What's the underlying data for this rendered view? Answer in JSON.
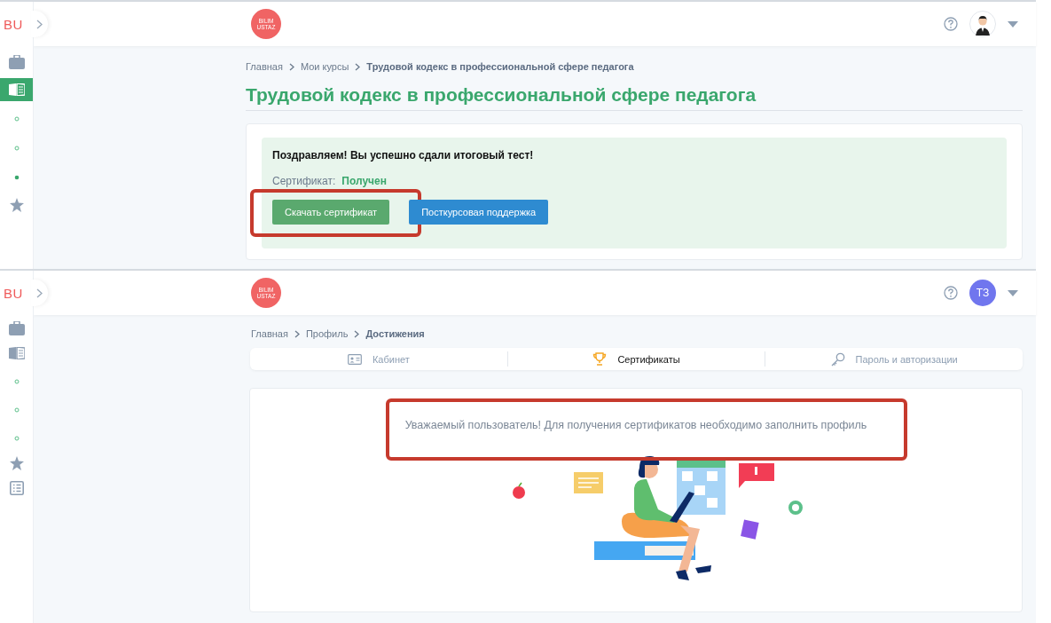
{
  "screens": [
    {
      "kind": "course",
      "brand": "BU",
      "logo": "BILIM USTAZ",
      "avatar": {
        "kind": "picture"
      },
      "sidebar": {
        "items": [
          {
            "kind": "briefcase",
            "selected": false
          },
          {
            "kind": "book",
            "selected": true
          },
          {
            "kind": "dot",
            "selected": false
          },
          {
            "kind": "dot",
            "selected": false
          },
          {
            "kind": "dot",
            "selected": true
          },
          {
            "kind": "star",
            "selected": false
          }
        ]
      },
      "breadcrumbs": [
        {
          "label": "Главная",
          "current": false
        },
        {
          "label": "Мои курсы",
          "current": false
        },
        {
          "label": "Трудовой кодекс в профессиональной сфере педагога",
          "current": true
        }
      ],
      "title": "Трудовой кодекс в профессиональной сфере педагога",
      "result": {
        "message": "Поздравляем! Вы успешно сдали итоговый тест!",
        "certificate_label": "Сертификат:",
        "certificate_status": "Получен"
      },
      "buttons": [
        {
          "label": "Скачать сертификат",
          "kind": "success",
          "highlighted": true
        },
        {
          "label": "Посткурсовая поддержка",
          "kind": "primary",
          "highlighted": false
        }
      ]
    },
    {
      "kind": "profile",
      "brand": "BU",
      "logo": "BILIM USTAZ",
      "avatar": {
        "kind": "initials",
        "text": "ТЗ"
      },
      "sidebar": {
        "items": [
          {
            "kind": "briefcase",
            "selected": false
          },
          {
            "kind": "book",
            "selected": false
          },
          {
            "kind": "dot",
            "selected": false
          },
          {
            "kind": "dot",
            "selected": false
          },
          {
            "kind": "dot",
            "selected": false
          },
          {
            "kind": "star",
            "selected": false
          },
          {
            "kind": "list",
            "selected": false
          }
        ]
      },
      "breadcrumbs": [
        {
          "label": "Главная",
          "current": false
        },
        {
          "label": "Профиль",
          "current": false
        },
        {
          "label": "Достижения",
          "current": true
        }
      ],
      "tabs": [
        {
          "label": "Кабинет",
          "kind": "card",
          "selected": false
        },
        {
          "label": "Сертификаты",
          "kind": "trophy",
          "selected": true
        },
        {
          "label": "Пароль и авторизации",
          "kind": "key",
          "selected": false
        }
      ],
      "notice": {
        "text": "Уважаемый пользователь! Для получения сертификатов необходимо заполнить профиль",
        "highlighted": true
      }
    }
  ]
}
